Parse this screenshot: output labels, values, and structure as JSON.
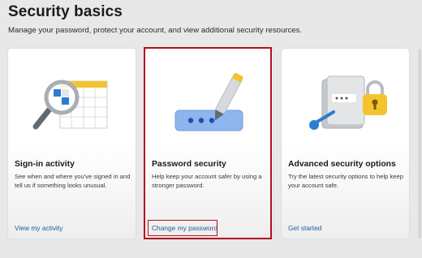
{
  "header": {
    "title": "Security basics",
    "subtitle": "Manage your password, protect your account, and view additional security resources."
  },
  "cards": [
    {
      "title": "Sign-in activity",
      "description": "See when and where you've signed in and tell us if something looks unusual.",
      "link": "View my activity",
      "icon": "magnifier-calendar-icon"
    },
    {
      "title": "Password security",
      "description": "Help keep your account safer by using a stronger password.",
      "link": "Change my password",
      "icon": "password-pen-icon"
    },
    {
      "title": "Advanced security options",
      "description": "Try the latest security options to help keep your account safe.",
      "link": "Get started",
      "icon": "book-padlock-key-icon"
    }
  ],
  "colors": {
    "accent": "#1b5e9c",
    "highlight": "#b2101e",
    "background": "#e8e8e8"
  }
}
